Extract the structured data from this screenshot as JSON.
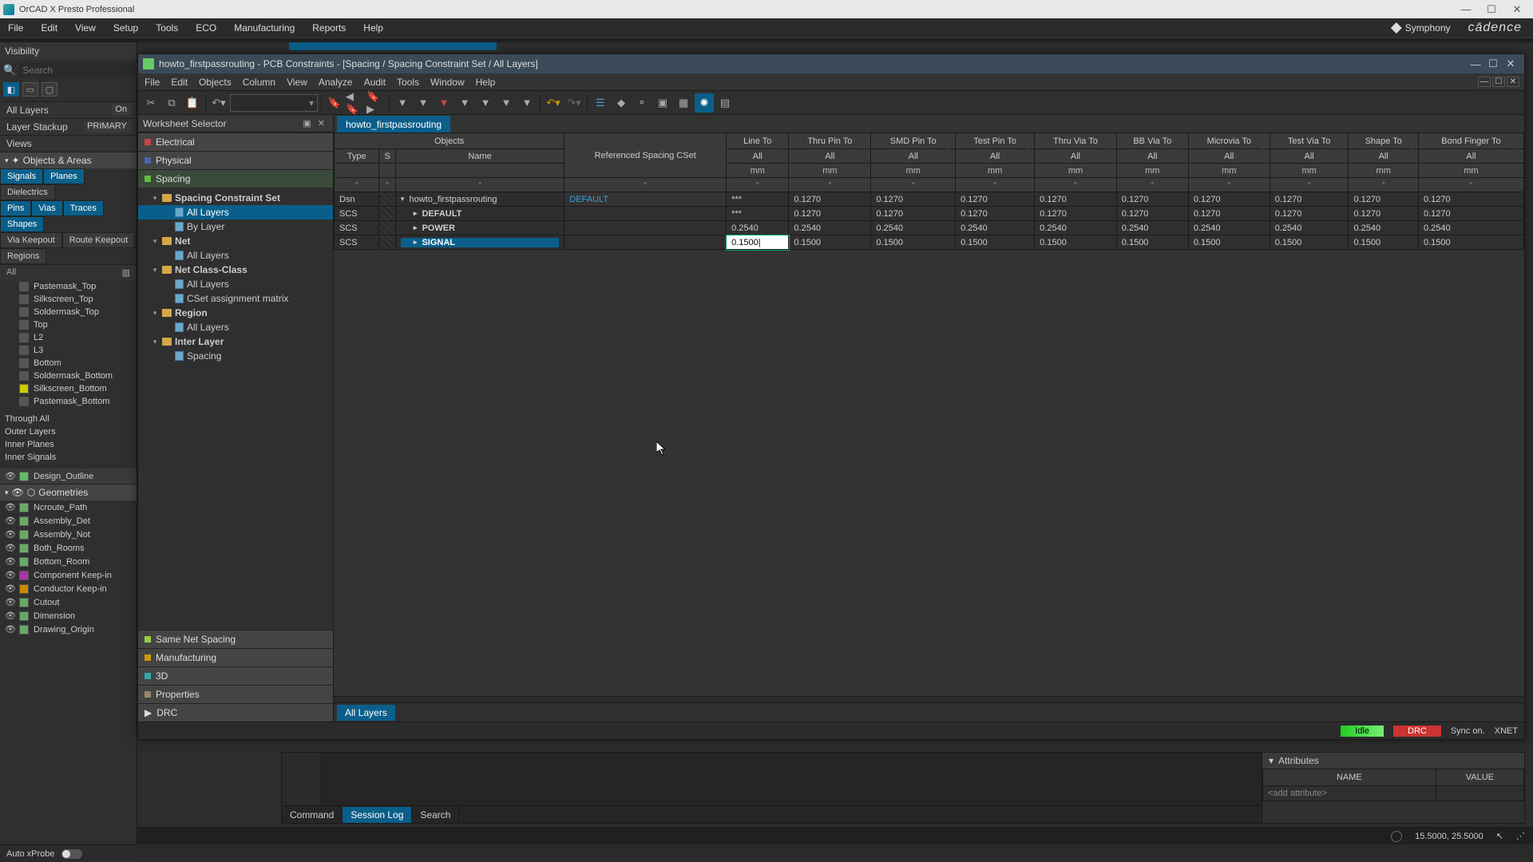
{
  "app": {
    "title": "OrCAD X Presto Professional"
  },
  "main_menu": [
    "File",
    "Edit",
    "View",
    "Setup",
    "Tools",
    "ECO",
    "Manufacturing",
    "Reports",
    "Help"
  ],
  "symphony": "Symphony",
  "brand": "cādence",
  "visibility": {
    "title": "Visibility",
    "search_placeholder": "Search",
    "all_layers": "All Layers",
    "all_layers_state": "On",
    "layer_stackup": "Layer Stackup",
    "layer_stackup_val": "PRIMARY",
    "views": "Views",
    "objects_areas": "Objects & Areas",
    "group1": [
      "Signals",
      "Planes",
      "Dielectrics"
    ],
    "group2": [
      "Pins",
      "Vias",
      "Traces",
      "Shapes"
    ],
    "group3": [
      "Via Keepout",
      "Route Keepout"
    ],
    "group4": [
      "Regions"
    ],
    "list_hdr_left": "All",
    "layers": [
      {
        "name": "Pastemask_Top",
        "color": "#555"
      },
      {
        "name": "Silkscreen_Top",
        "color": "#555"
      },
      {
        "name": "Soldermask_Top",
        "color": "#555"
      },
      {
        "name": "Top",
        "color": "#555"
      },
      {
        "name": "L2",
        "color": "#555"
      },
      {
        "name": "L3",
        "color": "#555"
      },
      {
        "name": "Bottom",
        "color": "#555"
      },
      {
        "name": "Soldermask_Bottom",
        "color": "#555"
      },
      {
        "name": "Silkscreen_Bottom",
        "color": "#cc0"
      },
      {
        "name": "Pastemask_Bottom",
        "color": "#555"
      }
    ],
    "sublayers": [
      "Through All",
      "Outer Layers",
      "Inner Planes",
      "Inner Signals"
    ],
    "design_outline": "Design_Outline",
    "geometries": "Geometries",
    "geoms": [
      {
        "name": "Ncroute_Path",
        "color": "#6a6"
      },
      {
        "name": "Assembly_Det",
        "color": "#6a6"
      },
      {
        "name": "Assembly_Not",
        "color": "#6a6"
      },
      {
        "name": "Both_Rooms",
        "color": "#6a6"
      },
      {
        "name": "Bottom_Room",
        "color": "#6a6"
      },
      {
        "name": "Component Keep-in",
        "color": "#a3a"
      },
      {
        "name": "Conductor Keep-in",
        "color": "#c80"
      },
      {
        "name": "Cutout",
        "color": "#6a6"
      },
      {
        "name": "Dimension",
        "color": "#6a6"
      },
      {
        "name": "Drawing_Origin",
        "color": "#6a6"
      }
    ],
    "auto_xprobe": "Auto xProbe"
  },
  "cm": {
    "title": "howto_firstpassrouting - PCB Constraints - [Spacing / Spacing Constraint Set / All Layers]",
    "menu": [
      "File",
      "Edit",
      "Objects",
      "Column",
      "View",
      "Analyze",
      "Audit",
      "Tools",
      "Window",
      "Help"
    ],
    "ws_title": "Worksheet Selector",
    "sections": {
      "electrical": "Electrical",
      "physical": "Physical",
      "spacing": "Spacing",
      "same_net": "Same Net Spacing",
      "manufacturing": "Manufacturing",
      "three_d": "3D",
      "properties": "Properties",
      "drc": "DRC"
    },
    "tree": {
      "scs": "Spacing Constraint Set",
      "scs_all": "All Layers",
      "scs_by": "By Layer",
      "net": "Net",
      "net_all": "All Layers",
      "ncc": "Net Class-Class",
      "ncc_all": "All Layers",
      "ncc_matrix": "CSet assignment matrix",
      "region": "Region",
      "region_all": "All Layers",
      "inter": "Inter Layer",
      "inter_sp": "Spacing"
    },
    "tab": "howto_firstpassrouting",
    "headers": {
      "objects": "Objects",
      "type": "Type",
      "s": "S",
      "name": "Name",
      "ref": "Referenced Spacing CSet",
      "cols": [
        "Line To",
        "Thru Pin To",
        "SMD Pin To",
        "Test Pin To",
        "Thru Via To",
        "BB Via To",
        "Microvia To",
        "Test Via To",
        "Shape To",
        "Bond Finger To"
      ],
      "sub": "All",
      "unit": "mm",
      "filter": "*"
    },
    "rows": [
      {
        "type": "Dsn",
        "name": "howto_firstpassrouting",
        "ref": "DEFAULT",
        "line": "***",
        "vals": [
          "0.1270",
          "0.1270",
          "0.1270",
          "0.1270",
          "0.1270",
          "0.1270",
          "0.1270",
          "0.1270",
          "0.1270"
        ],
        "tw": "▾",
        "lvl": 0,
        "link": true
      },
      {
        "type": "SCS",
        "name": "DEFAULT",
        "ref": "",
        "line": "***",
        "vals": [
          "0.1270",
          "0.1270",
          "0.1270",
          "0.1270",
          "0.1270",
          "0.1270",
          "0.1270",
          "0.1270",
          "0.1270"
        ],
        "tw": "▸",
        "lvl": 1,
        "bold": true
      },
      {
        "type": "SCS",
        "name": "POWER",
        "ref": "",
        "line": "0.2540",
        "vals": [
          "0.2540",
          "0.2540",
          "0.2540",
          "0.2540",
          "0.2540",
          "0.2540",
          "0.2540",
          "0.2540",
          "0.2540"
        ],
        "tw": "▸",
        "lvl": 1,
        "bold": true
      },
      {
        "type": "SCS",
        "name": "SIGNAL",
        "ref": "",
        "line": "0.1500",
        "vals": [
          "0.1500",
          "0.1500",
          "0.1500",
          "0.1500",
          "0.1500",
          "0.1500",
          "0.1500",
          "0.1500",
          "0.1500"
        ],
        "tw": "▸",
        "lvl": 1,
        "bold": true,
        "hl": true,
        "editing": true
      }
    ],
    "bottom_tab": "All Layers",
    "status": {
      "idle": "Idle",
      "drc": "DRC",
      "sync": "Sync on.",
      "xnet": "XNET"
    }
  },
  "cmd_tabs": [
    "Command",
    "Session Log",
    "Search"
  ],
  "cmd_tabs_active": 1,
  "attributes": {
    "title": "Attributes",
    "col_name": "NAME",
    "col_value": "VALUE",
    "add": "<add attribute>"
  },
  "footer": {
    "coords": "15.5000, 25.5000"
  }
}
